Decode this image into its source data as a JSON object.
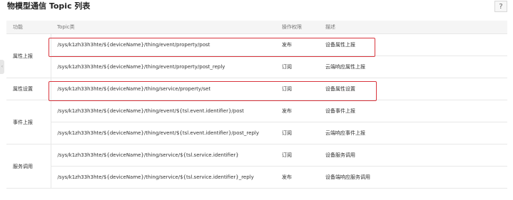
{
  "title": "物模型通信 Topic 列表",
  "help_label": "?",
  "columns": {
    "func": "功能",
    "topic": "Topic类",
    "perm": "操作权限",
    "desc": "描述"
  },
  "groups": [
    {
      "func": "属性上报",
      "rows": [
        {
          "topic": "/sys/k1zh33h3hte/${deviceName}/thing/event/property/post",
          "perm": "发布",
          "desc": "设备属性上报"
        },
        {
          "topic": "/sys/k1zh33h3hte/${deviceName}/thing/event/property/post_reply",
          "perm": "订阅",
          "desc": "云端响应属性上报"
        }
      ]
    },
    {
      "func": "属性设置",
      "rows": [
        {
          "topic": "/sys/k1zh33h3hte/${deviceName}/thing/service/property/set",
          "perm": "订阅",
          "desc": "设备属性设置"
        }
      ]
    },
    {
      "func": "事件上报",
      "rows": [
        {
          "topic": "/sys/k1zh33h3hte/${deviceName}/thing/event/${tsl.event.identifier}/post",
          "perm": "发布",
          "desc": "设备事件上报"
        },
        {
          "topic": "/sys/k1zh33h3hte/${deviceName}/thing/event/${tsl.event.identifier}/post_reply",
          "perm": "订阅",
          "desc": "云端响应事件上报"
        }
      ]
    },
    {
      "func": "服务调用",
      "rows": [
        {
          "topic": "/sys/k1zh33h3hte/${deviceName}/thing/service/${tsl.service.identifier}",
          "perm": "订阅",
          "desc": "设备服务调用"
        },
        {
          "topic": "/sys/k1zh33h3hte/${deviceName}/thing/service/${tsl.service.identifier}_reply",
          "perm": "发布",
          "desc": "设备端响应服务调用"
        }
      ]
    }
  ],
  "highlight_color": "#d9363e"
}
